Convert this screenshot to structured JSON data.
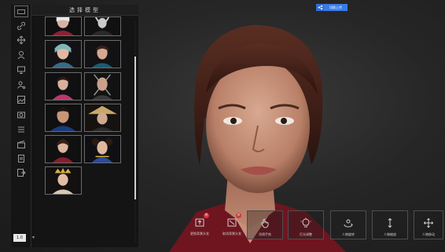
{
  "panel": {
    "title": "选择模型"
  },
  "toolbar": {
    "tools": [
      {
        "icon": "link-icon"
      },
      {
        "icon": "move-arrows-icon"
      },
      {
        "icon": "person-icon"
      },
      {
        "icon": "monitor-icon"
      },
      {
        "icon": "person-settings-icon"
      },
      {
        "icon": "image-frame-icon"
      },
      {
        "icon": "camera-icon"
      },
      {
        "icon": "list-icon"
      },
      {
        "icon": "clapperboard-icon"
      },
      {
        "icon": "document-icon"
      },
      {
        "icon": "export-icon"
      }
    ]
  },
  "models": [
    {
      "name": "model-thumb-1"
    },
    {
      "name": "model-thumb-2"
    },
    {
      "name": "model-thumb-3"
    },
    {
      "name": "model-thumb-4"
    },
    {
      "name": "model-thumb-5"
    },
    {
      "name": "model-thumb-6"
    },
    {
      "name": "model-thumb-7"
    },
    {
      "name": "model-thumb-8"
    },
    {
      "name": "model-thumb-9"
    },
    {
      "name": "model-thumb-10"
    },
    {
      "name": "model-thumb-11"
    }
  ],
  "version": {
    "label": "1.0"
  },
  "top_badge": {
    "label": "切换上传"
  },
  "actions": [
    {
      "label": "更换背景头发",
      "icon": "background-remove-icon"
    },
    {
      "label": "取消背景头发",
      "icon": "background-cancel-icon"
    },
    {
      "label": "涂鸦手势",
      "icon": "hand-gesture-icon"
    },
    {
      "label": "灯光调整",
      "icon": "light-bulb-icon"
    },
    {
      "label": "人物旋转",
      "icon": "rotate-person-icon"
    },
    {
      "label": "人物缩放",
      "icon": "scale-vertical-icon"
    },
    {
      "label": "人物移动",
      "icon": "move-person-icon"
    }
  ],
  "colors": {
    "accent": "#3a7be8",
    "danger": "#d23a3a",
    "panel_bg": "#141414"
  }
}
